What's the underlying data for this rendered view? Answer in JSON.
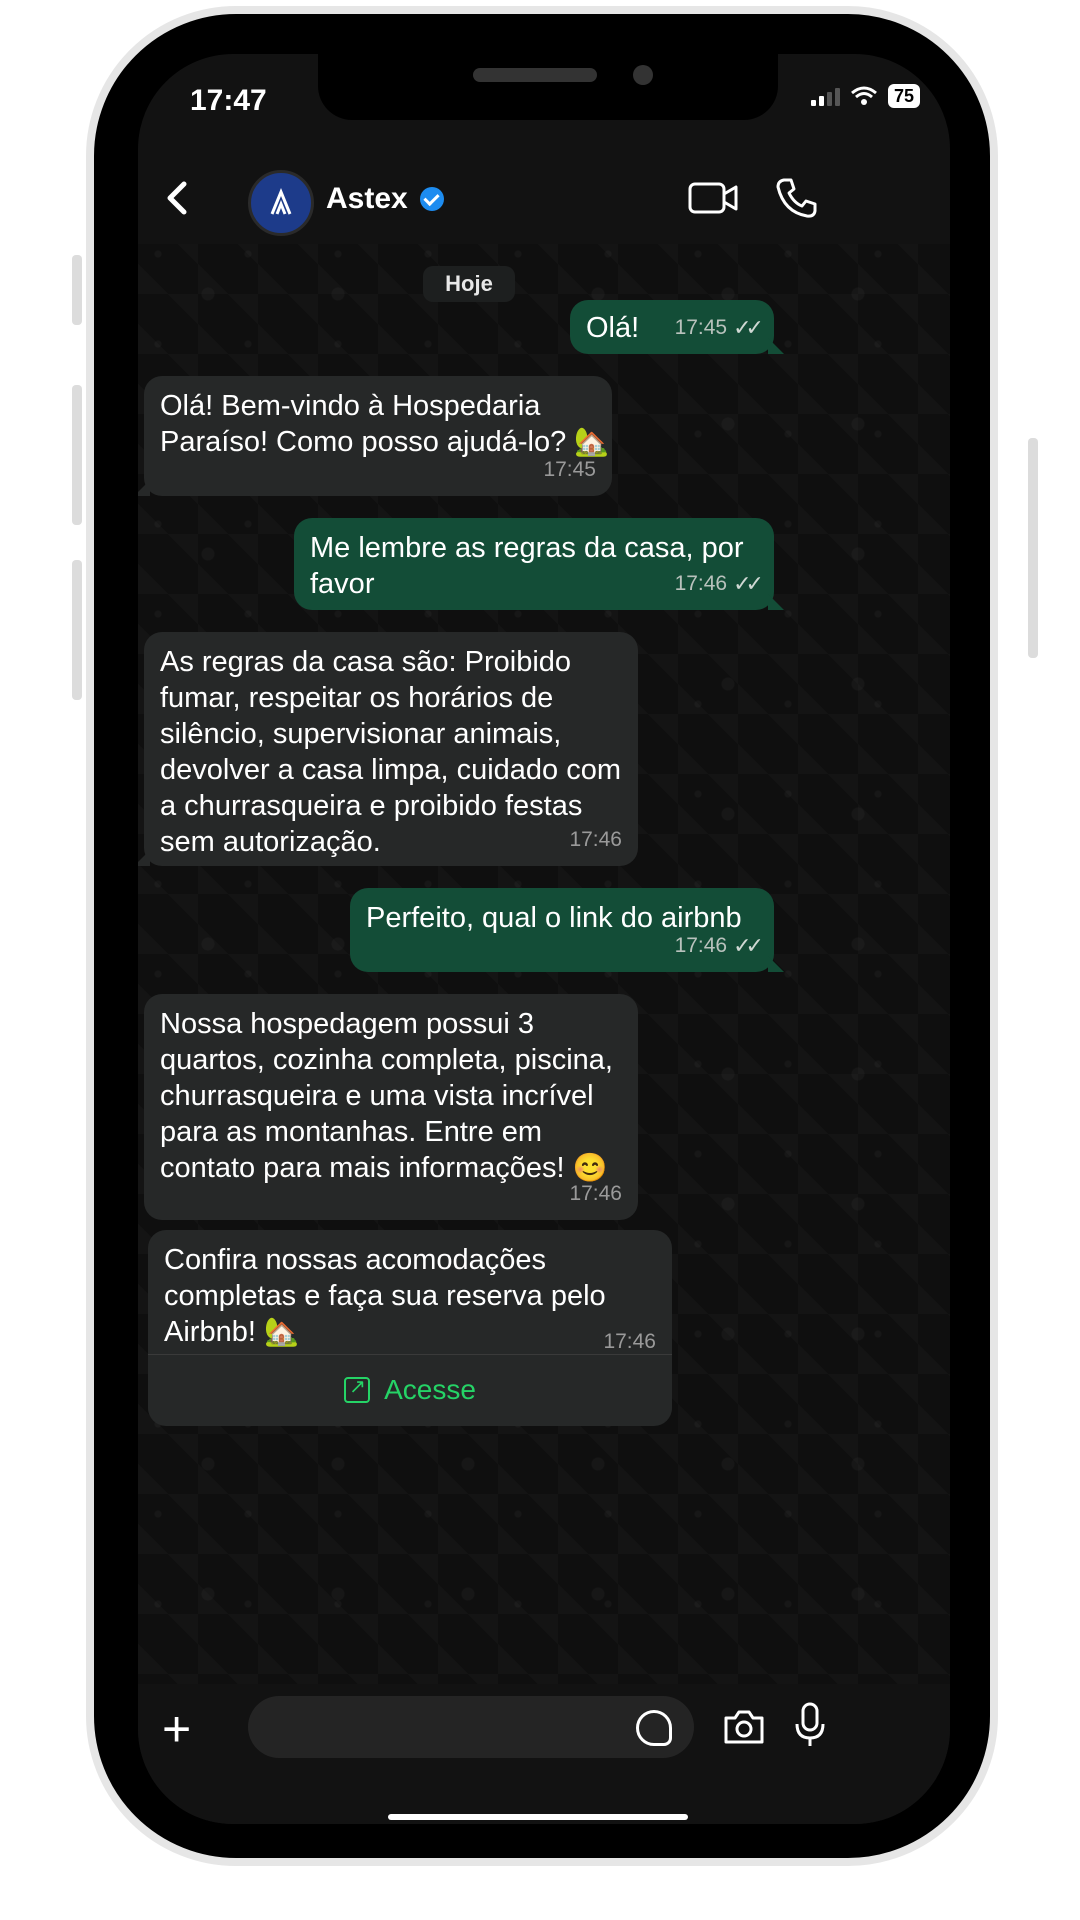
{
  "status_bar": {
    "time": "17:47",
    "battery": "75"
  },
  "header": {
    "contact_name": "Astex"
  },
  "chat": {
    "day_label": "Hoje",
    "messages": [
      {
        "dir": "out",
        "text": "Olá!",
        "time": "17:45"
      },
      {
        "dir": "in",
        "text": "Olá! Bem-vindo à Hospedaria\nParaíso! Como posso ajudá-lo?",
        "emoji": "🏡",
        "time": "17:45"
      },
      {
        "dir": "out",
        "text": "Me lembre as regras da casa, por\nfavor",
        "time": "17:46"
      },
      {
        "dir": "in",
        "text": "As regras da casa são: Proibido\nfumar, respeitar os horários de\nsilêncio, supervisionar animais,\ndevolver a casa limpa, cuidado com\na churrasqueira e proibido festas\nsem autorização.",
        "time": "17:46"
      },
      {
        "dir": "out",
        "text": "Perfeito, qual o link do airbnb",
        "time": "17:46"
      },
      {
        "dir": "in",
        "text": "Nossa hospedagem possui 3\nquartos, cozinha completa, piscina,\nchurrasqueira e uma vista incrível\npara as montanhas. Entre em\ncontato para mais informações!",
        "emoji": "😊",
        "time": "17:46"
      },
      {
        "dir": "in",
        "text": "Confira nossas acomodações\ncompletas e faça sua reserva pelo\nAirbnb!",
        "emoji": "🏡",
        "time": "17:46"
      }
    ],
    "cta_label": "Acesse"
  },
  "icons": [
    "back-icon",
    "avatar-logo-icon",
    "verified-icon",
    "video-call-icon",
    "phone-call-icon",
    "double-check-icon",
    "external-link-icon",
    "plus-icon",
    "sticker-icon",
    "camera-icon",
    "mic-icon"
  ],
  "colors": {
    "outgoing_bubble": "#134d37",
    "incoming_bubble": "#262828",
    "accent": "#25d366",
    "verified": "#1d8cf0"
  }
}
